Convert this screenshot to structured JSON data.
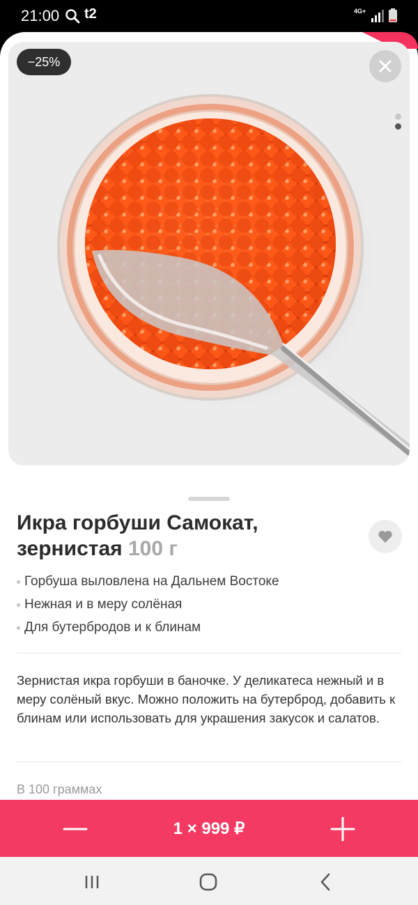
{
  "status_bar": {
    "time": "21:00",
    "carrier": "t2",
    "network": "4G+",
    "icons": [
      "search-icon",
      "signal-icon",
      "battery-icon"
    ]
  },
  "product": {
    "discount": "−25%",
    "image_icon": "caviar-photo",
    "title": "Икра горбуши Самокат, зернистая",
    "weight": "100 г",
    "features": [
      "Горбуша выловлена на Дальнем Востоке",
      "Нежная и в меру солёная",
      "Для бутербродов и к блинам"
    ],
    "description": "Зернистая икра горбуши в баночке. У деликатеса нежный и в меру солёный вкус. Можно положить на бутерброд, добавить к блинам или использовать для украшения закусок и салатов.",
    "nutrition_label": "В 100 граммах",
    "image_pages": 2,
    "active_image_page": 2
  },
  "cart": {
    "summary": "1 × 999 ₽",
    "minus_icon": "minus-icon",
    "plus_icon": "plus-icon"
  },
  "colors": {
    "accent": "#f43a62",
    "badge": "#2f2f2f",
    "title": "#2b2b2b",
    "weight": "#a8a8a8"
  },
  "nav_bar": {
    "icons": [
      "recents-icon",
      "home-icon",
      "back-icon"
    ]
  }
}
